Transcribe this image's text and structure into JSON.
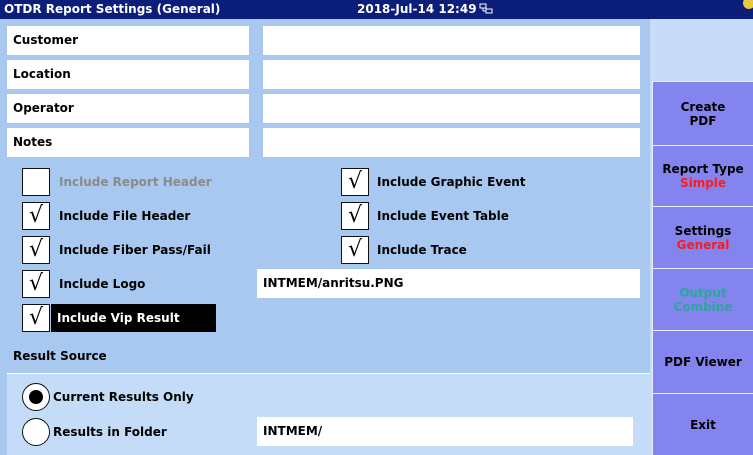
{
  "window": {
    "title": "OTDR Report Settings (General)",
    "datetime": "2018-Jul-14 12:49",
    "network_icon": "network-icon",
    "corner_icon": "corner-indicator-icon"
  },
  "fields": [
    {
      "label": "Customer",
      "value": ""
    },
    {
      "label": "Location",
      "value": ""
    },
    {
      "label": "Operator",
      "value": ""
    },
    {
      "label": "Notes",
      "value": ""
    }
  ],
  "options": {
    "include_report_header": {
      "label": "Include Report Header",
      "checked": false,
      "enabled": false
    },
    "include_file_header": {
      "label": "Include File Header",
      "checked": true
    },
    "include_fiber_pass_fail": {
      "label": "Include Fiber Pass/Fail",
      "checked": true
    },
    "include_logo": {
      "label": "Include Logo",
      "checked": true
    },
    "include_vip_result": {
      "label": "Include Vip Result",
      "checked": true,
      "selected": true
    },
    "include_graphic_event": {
      "label": "Include Graphic Event",
      "checked": true
    },
    "include_event_table": {
      "label": "Include Event Table",
      "checked": true
    },
    "include_trace": {
      "label": "Include Trace",
      "checked": true
    },
    "check_mark": "√"
  },
  "logo_path": "INTMEM/anritsu.PNG",
  "result_source": {
    "label": "Result Source",
    "options": [
      {
        "label": "Current Results Only",
        "selected": true
      },
      {
        "label": "Results in Folder",
        "selected": false
      }
    ],
    "folder_path": "INTMEM/"
  },
  "sidebar": {
    "create_pdf": {
      "line1": "Create",
      "line2": "PDF"
    },
    "report_type": {
      "label": "Report Type",
      "value": "Simple"
    },
    "settings": {
      "label": "Settings",
      "value": "General"
    },
    "output": {
      "label": "Output",
      "value": "Combine",
      "enabled": false
    },
    "pdf_viewer": {
      "label": "PDF Viewer"
    },
    "exit": {
      "label": "Exit"
    }
  },
  "colors": {
    "title_bar": "#0a1e7a",
    "panel_bg": "#a8c8f0",
    "button_bg": "#8484ee",
    "highlight_value": "#ff1a1a",
    "disabled_text": "#2aa79a"
  }
}
